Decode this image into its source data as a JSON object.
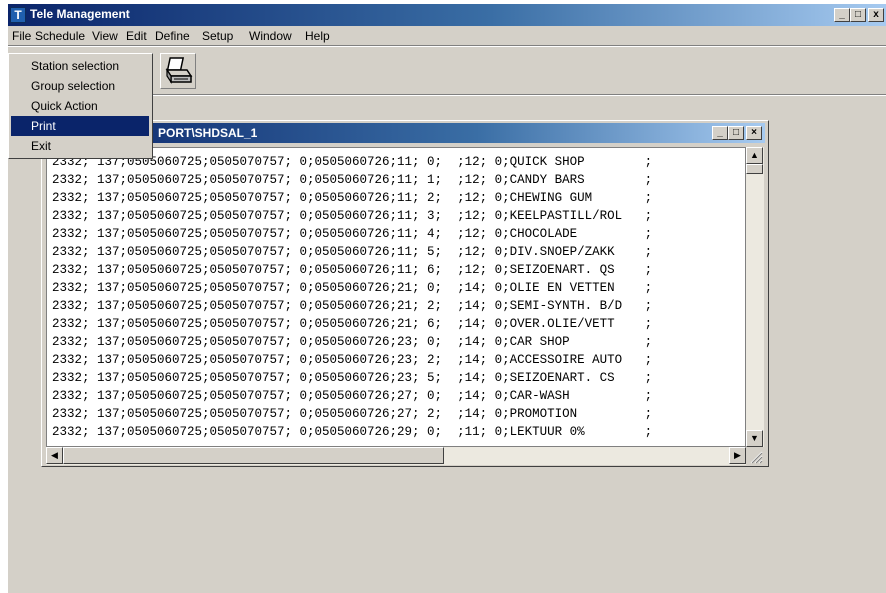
{
  "app": {
    "title": "Tele Management",
    "icon_letter": "T",
    "window_controls": {
      "minimize": "_",
      "maximize": "□",
      "close": "x"
    }
  },
  "menubar": {
    "items": [
      "File",
      "Schedule",
      "View",
      "Edit",
      "Define",
      "Setup",
      "Window",
      "Help"
    ]
  },
  "toolbar": {
    "print_icon": "printer-icon"
  },
  "file_menu": {
    "items": [
      "Station selection",
      "Group selection",
      "Quick Action",
      "Print",
      "Exit"
    ],
    "selected": "Print"
  },
  "child_window": {
    "title": "PORT\\SHDSAL_1",
    "controls": {
      "minimize": "_",
      "maximize": "□",
      "close": "×"
    },
    "lines": [
      "2332; 137;0505060725;0505070757; 0;0505060726;11; 0;  ;12; 0;QUICK SHOP        ;",
      "2332; 137;0505060725;0505070757; 0;0505060726;11; 1;  ;12; 0;CANDY BARS        ;",
      "2332; 137;0505060725;0505070757; 0;0505060726;11; 2;  ;12; 0;CHEWING GUM       ;",
      "2332; 137;0505060725;0505070757; 0;0505060726;11; 3;  ;12; 0;KEELPASTILL/ROL   ;",
      "2332; 137;0505060725;0505070757; 0;0505060726;11; 4;  ;12; 0;CHOCOLADE         ;",
      "2332; 137;0505060725;0505070757; 0;0505060726;11; 5;  ;12; 0;DIV.SNOEP/ZAKK    ;",
      "2332; 137;0505060725;0505070757; 0;0505060726;11; 6;  ;12; 0;SEIZOENART. QS    ;",
      "2332; 137;0505060725;0505070757; 0;0505060726;21; 0;  ;14; 0;OLIE EN VETTEN    ;",
      "2332; 137;0505060725;0505070757; 0;0505060726;21; 2;  ;14; 0;SEMI-SYNTH. B/D   ;",
      "2332; 137;0505060725;0505070757; 0;0505060726;21; 6;  ;14; 0;OVER.OLIE/VETT    ;",
      "2332; 137;0505060725;0505070757; 0;0505060726;23; 0;  ;14; 0;CAR SHOP          ;",
      "2332; 137;0505060725;0505070757; 0;0505060726;23; 2;  ;14; 0;ACCESSOIRE AUTO   ;",
      "2332; 137;0505060725;0505070757; 0;0505060726;23; 5;  ;14; 0;SEIZOENART. CS    ;",
      "2332; 137;0505060725;0505070757; 0;0505060726;27; 0;  ;14; 0;CAR-WASH          ;",
      "2332; 137;0505060725;0505070757; 0;0505060726;27; 2;  ;14; 0;PROMOTION         ;",
      "2332; 137;0505060725;0505070757; 0;0505060726;29; 0;  ;11; 0;LEKTUUR 0%        ;"
    ]
  }
}
